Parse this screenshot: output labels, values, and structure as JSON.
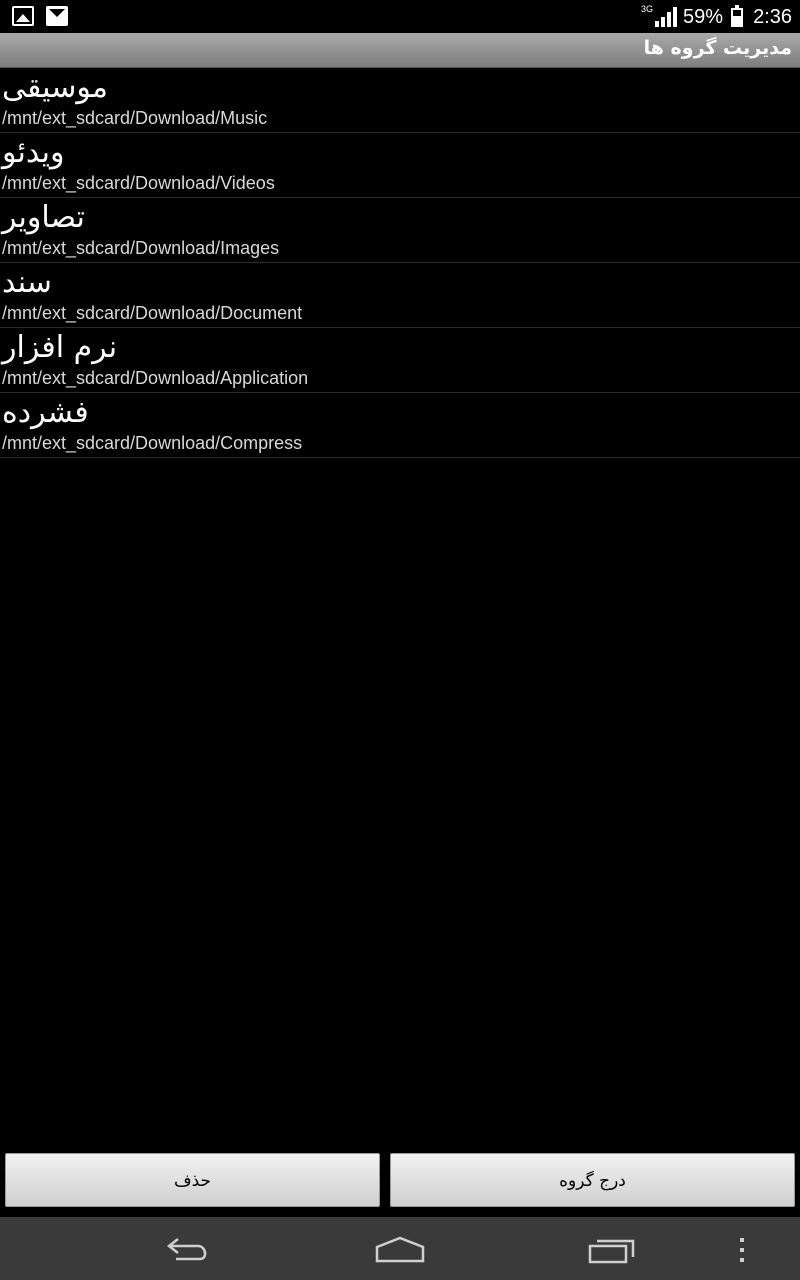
{
  "status_bar": {
    "network": "3G",
    "battery": "59%",
    "time": "2:36",
    "left_icons": [
      "gallery-icon",
      "mail-icon"
    ]
  },
  "header": {
    "title": "مدیریت گروه ها"
  },
  "groups": [
    {
      "name": "موسیقی",
      "path": "/mnt/ext_sdcard/Download/Music"
    },
    {
      "name": "ویدئو",
      "path": "/mnt/ext_sdcard/Download/Videos"
    },
    {
      "name": "تصاویر",
      "path": "/mnt/ext_sdcard/Download/Images"
    },
    {
      "name": "سند",
      "path": "/mnt/ext_sdcard/Download/Document"
    },
    {
      "name": "نرم افزار",
      "path": "/mnt/ext_sdcard/Download/Application"
    },
    {
      "name": "فشرده",
      "path": "/mnt/ext_sdcard/Download/Compress"
    }
  ],
  "buttons": {
    "delete_label": "حذف",
    "insert_label": "درج گروه"
  },
  "nav_bar": {
    "icons": [
      "back-icon",
      "home-icon",
      "recent-apps-icon",
      "overflow-menu-icon"
    ]
  }
}
